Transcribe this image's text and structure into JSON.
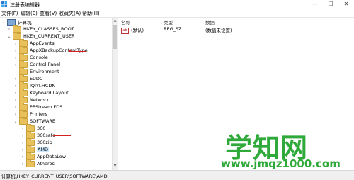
{
  "window": {
    "title": "注册表编辑器",
    "controls": {
      "minimize": "—",
      "maximize": "☐",
      "close": "✕"
    }
  },
  "menu": [
    "文件(F)",
    "编辑(E)",
    "查看(V)",
    "收藏夹(A)",
    "帮助(H)"
  ],
  "tree": {
    "root": "计算机",
    "nodes": [
      {
        "label": "HKEY_CLASSES_ROOT",
        "expander": "›"
      },
      {
        "label": "HKEY_CURRENT_USER",
        "expander": "⌄"
      },
      {
        "label": "AppEvents",
        "expander": "›"
      },
      {
        "label": "AppXBackupContentType",
        "expander": "›"
      },
      {
        "label": "Console",
        "expander": "›"
      },
      {
        "label": "Control Panel",
        "expander": "›"
      },
      {
        "label": "Environment",
        "expander": ""
      },
      {
        "label": "EUDC",
        "expander": "›"
      },
      {
        "label": "IQIYI.HCDN",
        "expander": "›"
      },
      {
        "label": "Keyboard Layout",
        "expander": "›"
      },
      {
        "label": "Network",
        "expander": "›"
      },
      {
        "label": "PPStream.FDS",
        "expander": "›"
      },
      {
        "label": "Printers",
        "expander": "›"
      },
      {
        "label": "SOFTWARE",
        "expander": "⌄"
      },
      {
        "label": "360",
        "expander": "›"
      },
      {
        "label": "360safe",
        "expander": "›"
      },
      {
        "label": "360zip",
        "expander": "›"
      },
      {
        "label": "AMD",
        "expander": "›"
      },
      {
        "label": "AppDataLow",
        "expander": "›"
      },
      {
        "label": "Atheros",
        "expander": "›"
      }
    ]
  },
  "list": {
    "columns": [
      "名称",
      "类型",
      "数据"
    ],
    "rows": [
      {
        "icon": "ab",
        "name": "(默认)",
        "type": "REG_SZ",
        "data": "(数值未设置)"
      }
    ]
  },
  "statusbar": {
    "path": "计算机\\HKEY_CURRENT_USER\\SOFTWARE\\AMD"
  },
  "watermark": {
    "text": "学知网",
    "url": "www.jmqz1000.com"
  },
  "colors": {
    "folder": "#e8c15a",
    "selection": "#cce8ff",
    "annotation": "#d42121",
    "watermark": "#2faa3a"
  }
}
